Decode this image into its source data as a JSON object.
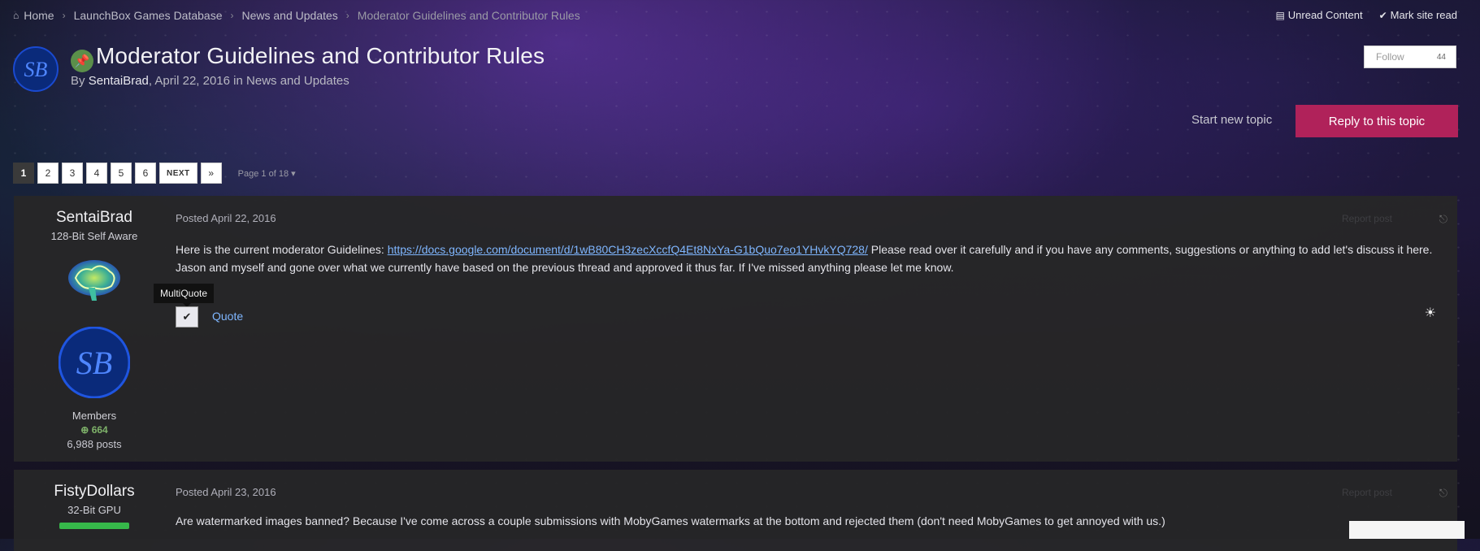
{
  "breadcrumb": {
    "items": [
      "Home",
      "LaunchBox Games Database",
      "News and Updates",
      "Moderator Guidelines and Contributor Rules"
    ]
  },
  "top_actions": {
    "unread": "Unread Content",
    "mark_read": "Mark site read"
  },
  "header": {
    "title": "Moderator Guidelines and Contributor Rules",
    "by": "By",
    "author": "SentaiBrad",
    "date": "April 22, 2016",
    "in": "in",
    "forum": "News and Updates",
    "follow_label": "Follow",
    "follow_count": "44",
    "start_topic": "Start new topic",
    "reply": "Reply to this topic"
  },
  "pagination": {
    "pages": [
      "1",
      "2",
      "3",
      "4",
      "5",
      "6"
    ],
    "next": "NEXT",
    "last": "»",
    "page_of": "Page 1 of 18"
  },
  "posts": [
    {
      "author": "SentaiBrad",
      "rank": "128-Bit Self Aware",
      "group": "Members",
      "reputation": "664",
      "post_count": "6,988 posts",
      "date": "Posted April 22, 2016",
      "body_pre": "Here is the current moderator Guidelines: ",
      "body_link": "https://docs.google.com/document/d/1wB80CH3zecXccfQ4Et8NxYa-G1bQuo7eo1YHvkYQ728/",
      "body_post": " Please read over it carefully and if you have any comments, suggestions or anything to add let's discuss it here. Jason and myself and gone over what we currently have based on the previous thread and approved it thus far. If I've missed anything please let me know.",
      "report": "Report post",
      "multiquote_tooltip": "MultiQuote",
      "quote": "Quote"
    },
    {
      "author": "FistyDollars",
      "rank": "32-Bit GPU",
      "date": "Posted April 23, 2016",
      "body": "Are watermarked images banned? Because I've come across a couple submissions with MobyGames watermarks at the bottom and rejected them (don't need MobyGames to get annoyed with us.)",
      "report": "Report post"
    }
  ],
  "colors": {
    "reply_button": "#b0225a",
    "link": "#7fb6ff",
    "pin_badge": "#5b8f4a",
    "reputation": "#7fb36a"
  }
}
